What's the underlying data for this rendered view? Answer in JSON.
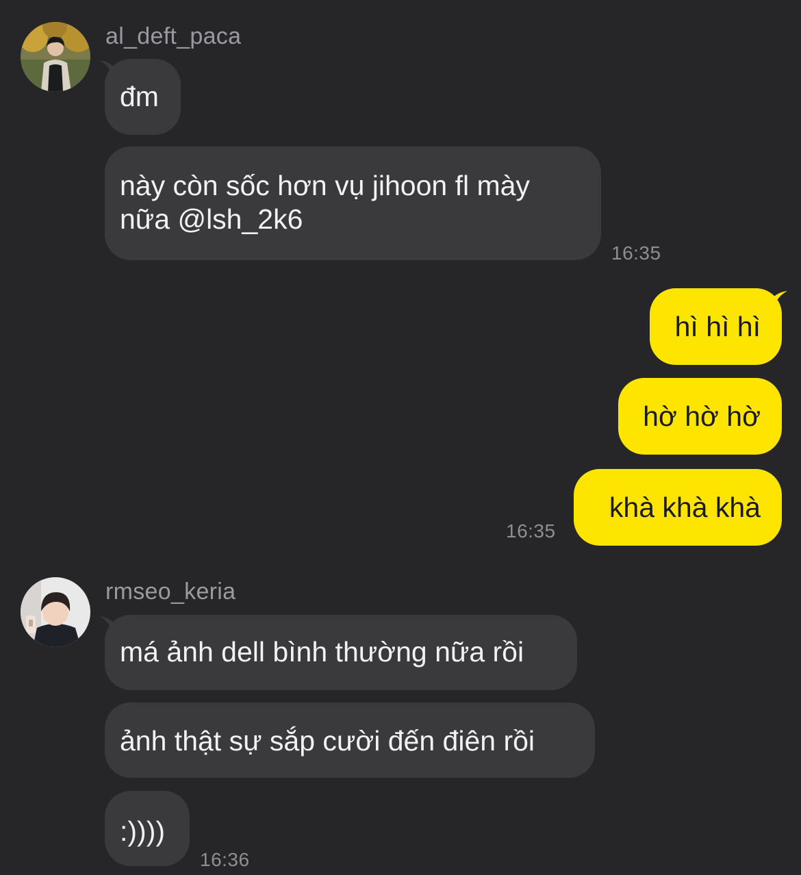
{
  "theme": {
    "background": "#262628",
    "incoming_bubble": "#3a3a3c",
    "outgoing_bubble": "#fee500",
    "sender_name_color": "#9a9aa0",
    "timestamp_color": "#8e8e93"
  },
  "chat": {
    "group1": {
      "sender": "al_deft_paca",
      "avatar": "user-avatar-photo",
      "messages": [
        "đm",
        "này còn sốc hơn vụ jihoon fl mày nữa @lsh_2k6"
      ],
      "time": "16:35"
    },
    "group2": {
      "sender": "me",
      "messages": [
        "hì hì hì",
        "hờ hờ hờ",
        "khà khà khà"
      ],
      "time": "16:35"
    },
    "group3": {
      "sender": "rmseo_keria",
      "avatar": "user-avatar-photo",
      "messages": [
        "má ảnh dell bình thường nữa rồi",
        "ảnh thật sự sắp cười đến điên rồi",
        ":))))"
      ],
      "time": "16:36"
    }
  }
}
